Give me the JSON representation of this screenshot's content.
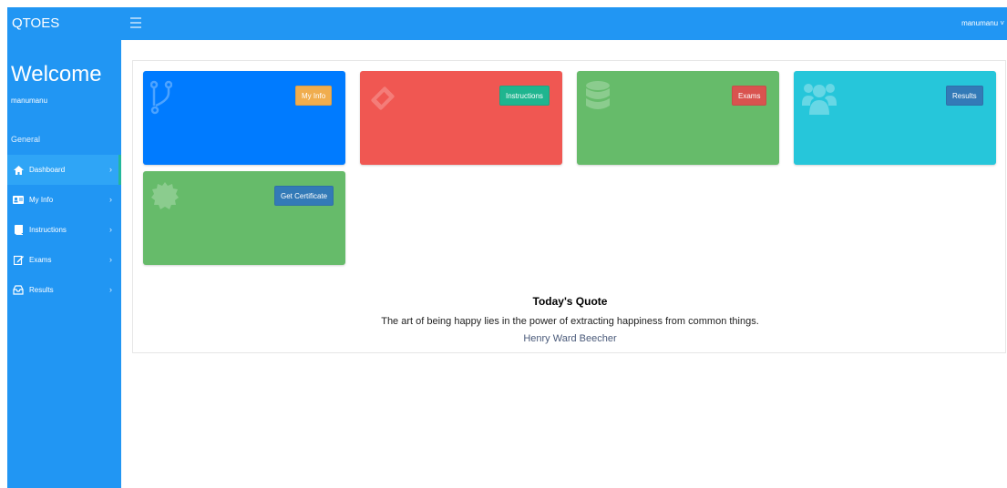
{
  "app": {
    "brand": "QTOES"
  },
  "sidebar": {
    "welcome": "Welcome",
    "username": "manumanu",
    "section": "General",
    "items": [
      {
        "label": "Dashboard",
        "icon": "home-icon",
        "active": true
      },
      {
        "label": "My Info",
        "icon": "id-card-icon"
      },
      {
        "label": "Instructions",
        "icon": "book-icon"
      },
      {
        "label": "Exams",
        "icon": "edit-icon"
      },
      {
        "label": "Results",
        "icon": "inbox-icon"
      }
    ]
  },
  "topbar": {
    "user": "manumanu"
  },
  "tiles": [
    {
      "name": "myinfo",
      "button": "My Info",
      "icon": "code-fork-icon",
      "color": "#007bff",
      "button_color": "#f0ad4e"
    },
    {
      "name": "instructions",
      "button": "Instructions",
      "icon": "ticket-icon",
      "color": "#f05752",
      "button_color": "#1fb58f"
    },
    {
      "name": "exams",
      "button": "Exams",
      "icon": "database-icon",
      "color": "#66bb6a",
      "button_color": "#d9534f"
    },
    {
      "name": "results",
      "button": "Results",
      "icon": "users-icon",
      "color": "#26c6da",
      "button_color": "#337ab7"
    },
    {
      "name": "certificate",
      "button": "Get Certificate",
      "icon": "certificate-icon",
      "color": "#66bb6a",
      "button_color": "#337ab7"
    }
  ],
  "quote": {
    "title": "Today's Quote",
    "text": "The art of being happy lies in the power of extracting happiness from common things.",
    "author": "Henry Ward Beecher"
  }
}
